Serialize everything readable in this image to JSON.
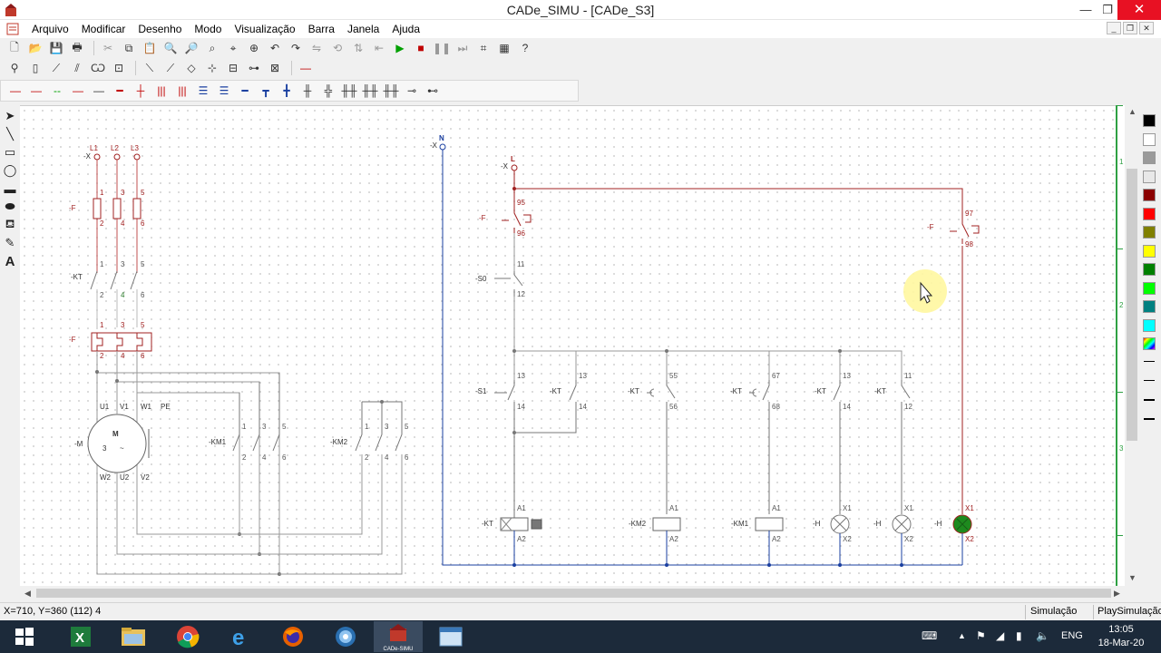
{
  "window": {
    "title": "CADe_SIMU - [CADe_S3]",
    "min": "—",
    "max": "❐",
    "close": "✕"
  },
  "menu": [
    "Arquivo",
    "Modificar",
    "Desenho",
    "Modo",
    "Visualização",
    "Barra",
    "Janela",
    "Ajuda"
  ],
  "labels": {
    "L1": "L1",
    "L2": "L2",
    "L3": "L3",
    "X": "-X",
    "F": "-F",
    "KT": "-KT",
    "KM1": "-KM1",
    "KM2": "-KM2",
    "M": "-M",
    "N": "N",
    "L": "L",
    "S0": "-S0",
    "S1": "-S1",
    "H": "-H",
    "U1": "U1",
    "V1": "V1",
    "W1": "W1",
    "PE": "PE",
    "W2": "W2",
    "U2": "U2",
    "V2": "V2",
    "motor_M": "M",
    "motor_3": "3",
    "n1": "1",
    "n2": "2",
    "n3": "3",
    "n4": "4",
    "n5": "5",
    "n6": "6",
    "n11": "11",
    "n12": "12",
    "n13": "13",
    "n14": "14",
    "n55": "55",
    "n56": "56",
    "n67": "67",
    "n68": "68",
    "n95": "95",
    "n96": "96",
    "n97": "97",
    "n98": "98",
    "A1": "A1",
    "A2": "A2",
    "X1": "X1",
    "X2": "X2",
    "r1": "1",
    "r2": "2",
    "r3": "3"
  },
  "status": {
    "coords": "X=710, Y=360 (112) 4",
    "mode": "Simulação",
    "play": "PlaySimulação"
  },
  "taskbar": {
    "time": "13:05",
    "date": "18-Mar-20",
    "lang": "ENG",
    "cade_label": "CADe-SIMU"
  },
  "colors": {
    "accent_red": "#a02020",
    "wire_blue": "#1a3fa0",
    "ruler_green": "#2ea043"
  }
}
